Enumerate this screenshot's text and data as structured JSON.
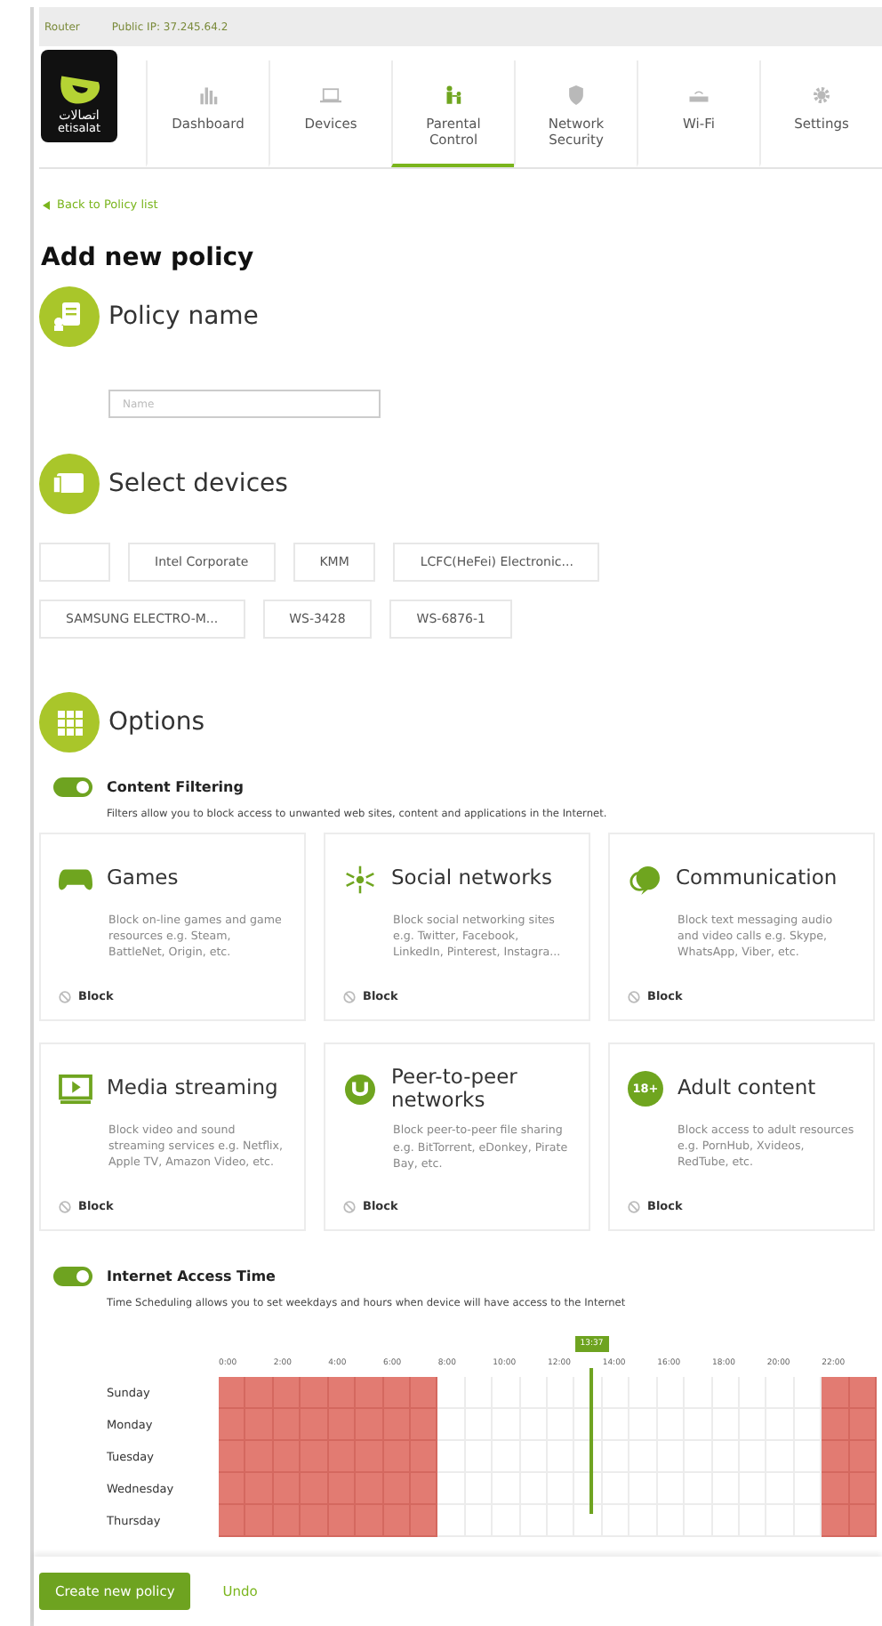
{
  "top_bar": {
    "router": "Router",
    "public_ip": "Public IP: 37.245.64.2"
  },
  "logo": {
    "text": "اتصالات",
    "brand": "etisalat"
  },
  "tabs": [
    {
      "label": "Dashboard",
      "kind": "chart",
      "selected": false
    },
    {
      "label": "Devices",
      "kind": "laptop",
      "selected": false
    },
    {
      "label": "Parental Control",
      "kind": "family",
      "selected": true
    },
    {
      "label": "Network Security",
      "kind": "shield",
      "selected": false
    },
    {
      "label": "Wi-Fi",
      "kind": "router",
      "selected": false
    },
    {
      "label": "Settings",
      "kind": "gear",
      "selected": false
    }
  ],
  "back_link": "Back to Policy list",
  "page_title": "Add new policy",
  "policy_name": {
    "title": "Policy name",
    "placeholder": "Name"
  },
  "select_devices": {
    "title": "Select devices",
    "devices": [
      {
        "selected": false
      },
      {
        "label": "Intel Corporate",
        "selected": false
      },
      {
        "label": "KMM",
        "selected": false
      },
      {
        "label": "LCFC(HeFei) Electronic...",
        "selected": false
      },
      {
        "label": "SAMSUNG ELECTRO-M...",
        "selected": false
      },
      {
        "label": "WS-3428",
        "selected": false
      },
      {
        "label": "WS-6876-1",
        "selected": false
      }
    ]
  },
  "options": {
    "title": "Options",
    "content_filtering": {
      "label": "Content Filtering",
      "on": true,
      "description": "Filters allow you to block access to unwanted web sites, content and applications in the Internet.",
      "categories": [
        {
          "kind": "games",
          "title": "Games",
          "description": "Block on-line games and game resources e.g. Steam, BattleNet, Origin, etc.",
          "action": "Block",
          "blocked": false
        },
        {
          "kind": "social",
          "title": "Social networks",
          "description": "Block social networking sites e.g. Twitter, Facebook, LinkedIn, Pinterest, Instagra...",
          "action": "Block",
          "blocked": false
        },
        {
          "kind": "chat",
          "title": "Communication",
          "description": "Block text messaging audio and video calls e.g. Skype, WhatsApp, Viber, etc.",
          "action": "Block",
          "blocked": false
        },
        {
          "kind": "media",
          "title": "Media streaming",
          "description": "Block video and sound streaming services e.g. Netflix, Apple TV, Amazon Video, etc.",
          "action": "Block",
          "blocked": false
        },
        {
          "kind": "p2p",
          "title": "Peer-to-peer networks",
          "description": "Block peer-to-peer file sharing e.g. BitTorrent, eDonkey, Pirate Bay, etc.",
          "action": "Block",
          "blocked": false
        },
        {
          "kind": "adult",
          "title": "Adult content",
          "badge": "18+",
          "description": "Block access to adult resources e.g. PornHub, Xvideos, RedTube, etc.",
          "action": "Block",
          "blocked": false
        }
      ]
    },
    "internet_access_time": {
      "label": "Internet Access Time",
      "on": true,
      "description": "Time Scheduling allows you to set weekdays and hours when device will have access to the Internet",
      "hour_labels": [
        "0:00",
        "2:00",
        "4:00",
        "6:00",
        "8:00",
        "10:00",
        "12:00",
        "14:00",
        "16:00",
        "18:00",
        "20:00",
        "22:00"
      ],
      "now": {
        "label": "13:37",
        "level": 0.567
      },
      "days": [
        {
          "name": "Sunday",
          "hours": [
            true,
            true,
            true,
            true,
            true,
            true,
            true,
            true,
            false,
            false,
            false,
            false,
            false,
            false,
            false,
            false,
            false,
            false,
            false,
            false,
            false,
            false,
            true,
            true
          ]
        },
        {
          "name": "Monday",
          "hours": [
            true,
            true,
            true,
            true,
            true,
            true,
            true,
            true,
            false,
            false,
            false,
            false,
            false,
            false,
            false,
            false,
            false,
            false,
            false,
            false,
            false,
            false,
            true,
            true
          ]
        },
        {
          "name": "Tuesday",
          "hours": [
            true,
            true,
            true,
            true,
            true,
            true,
            true,
            true,
            false,
            false,
            false,
            false,
            false,
            false,
            false,
            false,
            false,
            false,
            false,
            false,
            false,
            false,
            true,
            true
          ]
        },
        {
          "name": "Wednesday",
          "hours": [
            true,
            true,
            true,
            true,
            true,
            true,
            true,
            true,
            false,
            false,
            false,
            false,
            false,
            false,
            false,
            false,
            false,
            false,
            false,
            false,
            false,
            false,
            true,
            true
          ]
        },
        {
          "name": "Thursday",
          "hours": [
            true,
            true,
            true,
            true,
            true,
            true,
            true,
            true,
            false,
            false,
            false,
            false,
            false,
            false,
            false,
            false,
            false,
            false,
            false,
            false,
            false,
            false,
            true,
            true
          ]
        }
      ]
    }
  },
  "footer": {
    "primary": "Create new policy",
    "secondary": "Undo"
  }
}
